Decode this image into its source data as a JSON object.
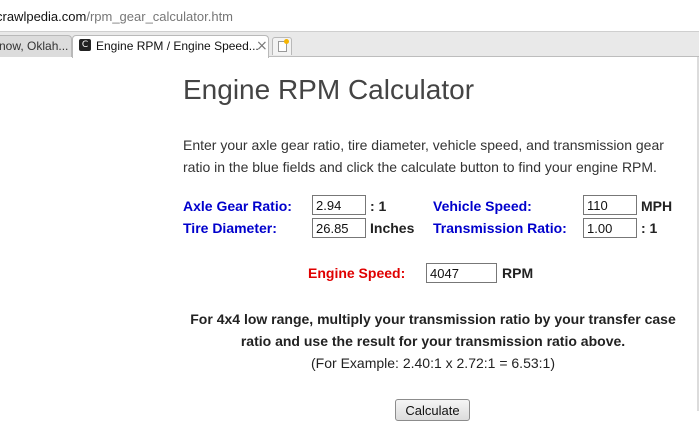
{
  "browser": {
    "url_host": "crawlpedia.com",
    "url_path": "/rpm_gear_calculator.htm",
    "tabs": [
      {
        "label": "now, Oklah..."
      },
      {
        "label": "Engine RPM / Engine Speed...",
        "close": "×"
      }
    ]
  },
  "page": {
    "title": "Engine RPM Calculator",
    "intro": "Enter your axle gear ratio, tire diameter, vehicle speed, and transmission gear ratio in the blue fields and click the calculate button to find your engine RPM.",
    "fields": {
      "axle_gear_ratio": {
        "label": "Axle Gear Ratio:",
        "value": "2.94",
        "unit": ": 1"
      },
      "tire_diameter": {
        "label": "Tire Diameter:",
        "value": "26.85",
        "unit": "Inches"
      },
      "vehicle_speed": {
        "label": "Vehicle Speed:",
        "value": "110",
        "unit": "MPH"
      },
      "transmission_ratio": {
        "label": "Transmission Ratio:",
        "value": "1.00",
        "unit": ": 1"
      },
      "engine_speed": {
        "label": "Engine Speed:",
        "value": "4047",
        "unit": "RPM"
      }
    },
    "note_line1": "For 4x4 low range, multiply your transmission ratio by your transfer case",
    "note_line2": "ratio and use the result for your transmission ratio above.",
    "example": "(For Example: 2.40:1 x 2.72:1 = 6.53:1)",
    "calculate_label": "Calculate"
  },
  "colors": {
    "input_label": "#0000cc",
    "result_label": "#e00000"
  }
}
